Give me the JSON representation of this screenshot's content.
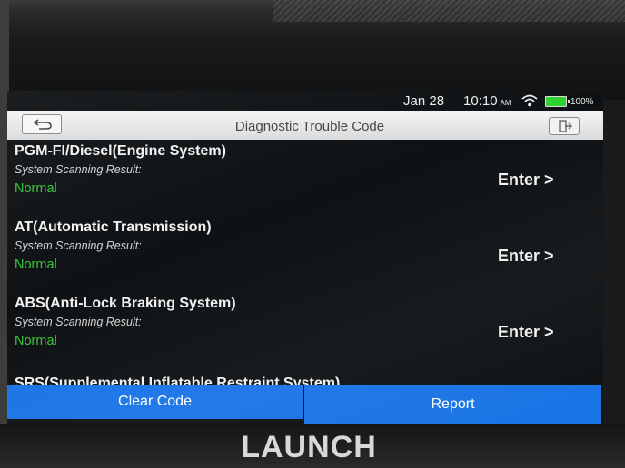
{
  "device": {
    "brand": "LAUNCH"
  },
  "status_bar": {
    "date": "Jan 28",
    "time": "10:10",
    "am_pm": "AM",
    "battery": "100%"
  },
  "header": {
    "title": "Diagnostic Trouble Code",
    "back_icon": "back-arrow-icon",
    "exit_icon": "exit-icon"
  },
  "systems": [
    {
      "name": "PGM-FI/Diesel(Engine System)",
      "subtitle": "System Scanning Result:",
      "status": "Normal",
      "action": "Enter >"
    },
    {
      "name": "AT(Automatic Transmission)",
      "subtitle": "System Scanning Result:",
      "status": "Normal",
      "action": "Enter >"
    },
    {
      "name": "ABS(Anti-Lock Braking System)",
      "subtitle": "System Scanning Result:",
      "status": "Normal",
      "action": "Enter >"
    },
    {
      "name": "SRS(Supplemental Inflatable Restraint System)"
    }
  ],
  "footer": {
    "clear_label": "Clear Code",
    "report_label": "Report"
  },
  "colors": {
    "accent": "#1a74e6",
    "status_normal": "#37c837",
    "battery": "#2fd12f"
  }
}
